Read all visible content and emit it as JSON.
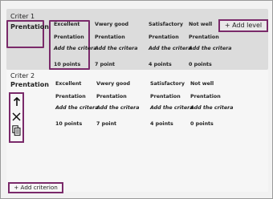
{
  "criteria": [
    {
      "title": "Criter 1",
      "name": "Prentation",
      "levels": [
        {
          "level": "Excellent",
          "name": "Prentation",
          "criteria": "Add the critera",
          "points": "10 points"
        },
        {
          "level": "Vwery good",
          "name": "Prentation",
          "criteria": "Add the critera",
          "points": "7 point"
        },
        {
          "level": "Satisfactory",
          "name": "Prentation",
          "criteria": "Add the critera",
          "points": "4 points"
        },
        {
          "level": "Not well",
          "name": "Prentation",
          "criteria": "Add the critera",
          "points": "0 points"
        }
      ],
      "add_level_label": "+ Add level"
    },
    {
      "title": "Criter 2",
      "name": "Prentation",
      "levels": [
        {
          "level": "Excellent",
          "name": "Prentation",
          "criteria": "Add the critera",
          "points": "10 points"
        },
        {
          "level": "Vwery good",
          "name": "Prentation",
          "criteria": "Add the critera",
          "points": "7 point"
        },
        {
          "level": "Satisfactory",
          "name": "Prentation",
          "criteria": "Add the critera",
          "points": "4 points"
        },
        {
          "level": "Not well",
          "name": "Prentation",
          "criteria": "Add the critera",
          "points": "0 points"
        }
      ],
      "actions": [
        "up-arrow-icon",
        "close-icon",
        "copy-icon"
      ]
    }
  ],
  "add_criterion_label": "+ Add criterion",
  "colors": {
    "highlight": "#7a2a6a",
    "panel": "#dcdcdc"
  }
}
